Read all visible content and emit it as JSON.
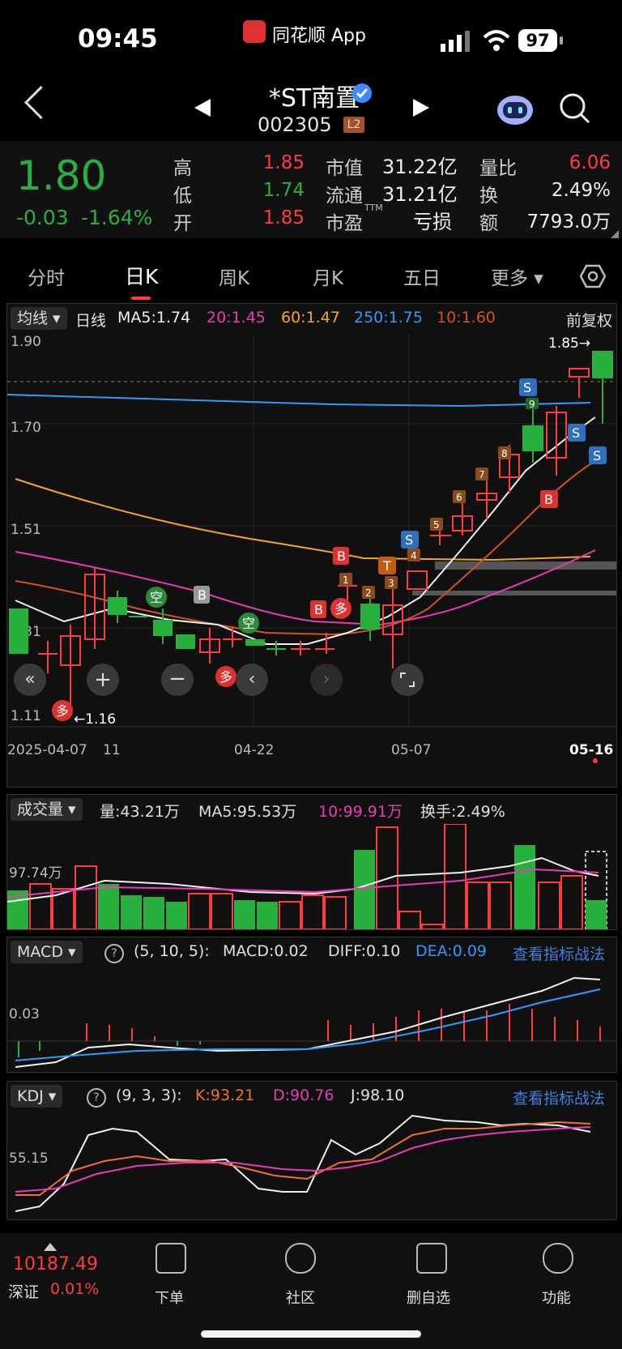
{
  "status_bar": {
    "time": "09:45",
    "app": "同花顺 App",
    "battery": "97"
  },
  "header": {
    "title": "*ST南置",
    "code": "002305",
    "badge": "L2"
  },
  "quote": {
    "price": "1.80",
    "change": "-0.03",
    "change_pct": "-1.64%",
    "rows": [
      {
        "l1": "高",
        "v1": "1.85",
        "l2": "市值",
        "v2": "31.22亿",
        "l3": "量比",
        "v3": "6.06"
      },
      {
        "l1": "低",
        "v1": "1.74",
        "l2": "流通",
        "v2": "31.21亿",
        "l3": "换",
        "v3": "2.49%"
      },
      {
        "l1": "开",
        "v1": "1.85",
        "l2": "市盈",
        "v2": "亏损",
        "l3": "额",
        "v3": "7793.0万"
      }
    ],
    "pe_suffix": "TTM"
  },
  "tabs": [
    "分时",
    "日K",
    "周K",
    "月K",
    "五日",
    "更多"
  ],
  "active_tab": "日K",
  "kline": {
    "chip": "均线",
    "period": "日线",
    "ma5": "MA5:1.74",
    "ma20": "20:1.45",
    "ma60": "60:1.47",
    "ma250": "250:1.75",
    "ma10": "10:1.60",
    "adjust": "前复权",
    "y_labels": [
      "1.90",
      "1.70",
      "1.51",
      "1.31",
      "1.11"
    ],
    "max_label": "1.85→",
    "min_label": "←1.16",
    "x_labels": [
      "2025-04-07",
      "11",
      "04-22",
      "05-07",
      "05-16"
    ]
  },
  "volume": {
    "chip": "成交量",
    "vol": "量:43.21万",
    "ma5": "MA5:95.53万",
    "ma10": "10:99.91万",
    "turnover": "换手:2.49%",
    "y_label": "97.74万"
  },
  "macd": {
    "chip": "MACD",
    "params": "(5, 10, 5):",
    "macd": "MACD:0.02",
    "diff": "DIFF:0.10",
    "dea": "DEA:0.09",
    "link": "查看指标战法",
    "y_label": "0.03"
  },
  "kdj": {
    "chip": "KDJ",
    "params": "(9, 3, 3):",
    "k": "K:93.21",
    "d": "D:90.76",
    "j": "J:98.10",
    "link": "查看指标战法",
    "y_label": "55.15"
  },
  "bottom": {
    "index_value": "10187.49",
    "index_name": "深证",
    "index_pct": "0.01%",
    "nav": [
      "下单",
      "社区",
      "删自选",
      "功能"
    ]
  },
  "colors": {
    "up": "#ff3b3b",
    "down": "#27b03d",
    "ma5": "#f0f0f0",
    "ma20": "#e83cb4",
    "ma60": "#f5a623",
    "ma250": "#2f9bff",
    "ma10": "#d2521e"
  }
}
